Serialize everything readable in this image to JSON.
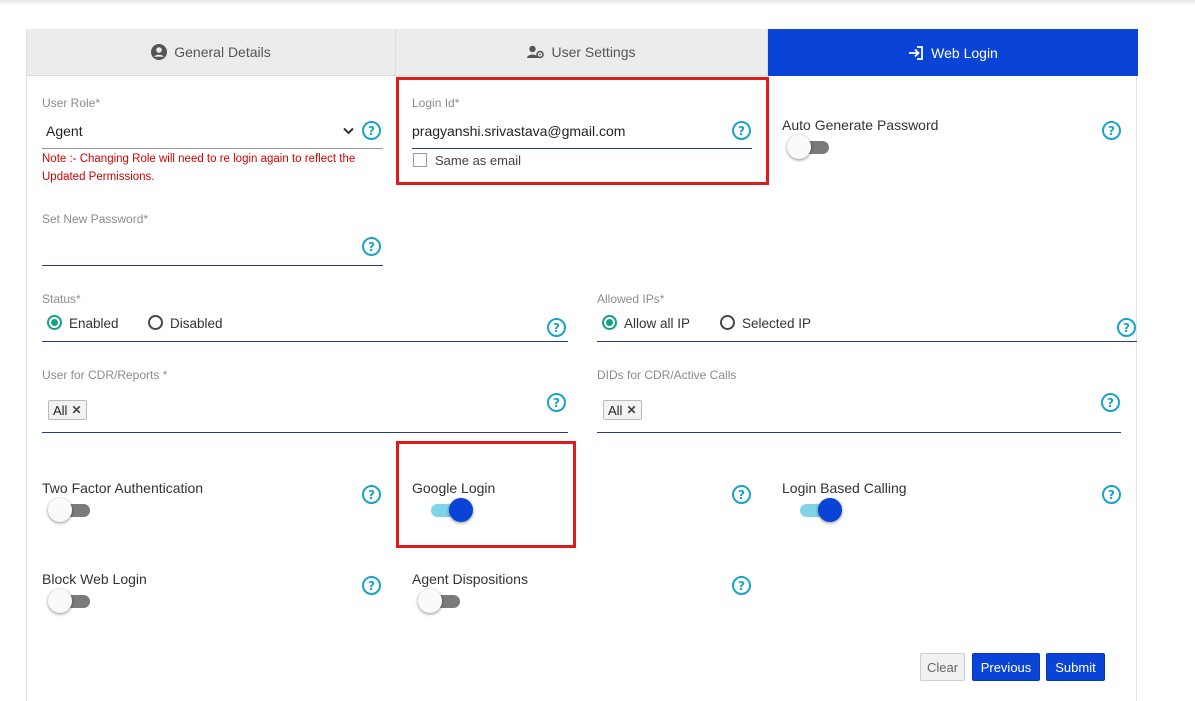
{
  "tabs": [
    {
      "label": "General Details",
      "icon": "user-circle-icon"
    },
    {
      "label": "User Settings",
      "icon": "user-cog-icon"
    },
    {
      "label": "Web Login",
      "icon": "login-icon",
      "active": true
    }
  ],
  "form": {
    "user_role": {
      "label": "User Role*",
      "value": "Agent",
      "note": "Note :- Changing Role will need to re login again to reflect the Updated Permissions."
    },
    "login_id": {
      "label": "Login Id*",
      "value": "pragyanshi.srivastava@gmail.com",
      "same_as_email_label": "Same as email",
      "same_as_email_checked": false
    },
    "auto_generate_password": {
      "label": "Auto Generate Password",
      "enabled": false
    },
    "new_password": {
      "label": "Set New Password*",
      "value": ""
    },
    "status": {
      "label": "Status*",
      "options": [
        "Enabled",
        "Disabled"
      ],
      "selected": "Enabled"
    },
    "allowed_ips": {
      "label": "Allowed IPs*",
      "options": [
        "Allow all IP",
        "Selected IP"
      ],
      "selected": "Allow all IP"
    },
    "user_for_cdr": {
      "label": "User for CDR/Reports *",
      "chips": [
        "All"
      ]
    },
    "dids_for_cdr": {
      "label": "DIDs for CDR/Active Calls",
      "chips": [
        "All"
      ]
    },
    "toggles": {
      "two_factor": {
        "label": "Two Factor Authentication",
        "enabled": false
      },
      "google_login": {
        "label": "Google Login",
        "enabled": true
      },
      "login_based_calling": {
        "label": "Login Based Calling",
        "enabled": true
      },
      "block_web_login": {
        "label": "Block Web Login",
        "enabled": false
      },
      "agent_dispositions": {
        "label": "Agent Dispositions",
        "enabled": false
      }
    }
  },
  "buttons": {
    "clear": "Clear",
    "previous": "Previous",
    "submit": "Submit"
  },
  "help_glyph": "?",
  "remove_glyph": "✕",
  "colors": {
    "accent": "#0a44d6",
    "highlight": "#e01b1b",
    "help": "#19a3c6",
    "note": "#d40000",
    "radio": "#16a085"
  }
}
